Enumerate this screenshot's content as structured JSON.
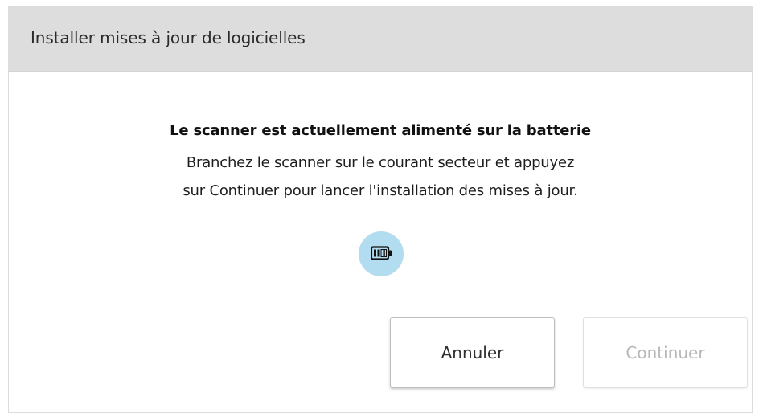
{
  "dialog": {
    "title": "Installer mises à jour de logicielles",
    "headline": "Le scanner est actuellement alimenté sur la batterie",
    "body_line1": "Branchez le scanner sur le courant secteur et appuyez",
    "body_line2": "sur Continuer pour lancer  l'installation des mises à jour.",
    "icon": "battery-icon",
    "buttons": {
      "cancel_label": "Annuler",
      "continue_label": "Continuer",
      "continue_enabled": false
    }
  },
  "colors": {
    "title_bar": "#dddddd",
    "badge": "#b2dcef",
    "disabled_text": "#b8b8b8"
  }
}
